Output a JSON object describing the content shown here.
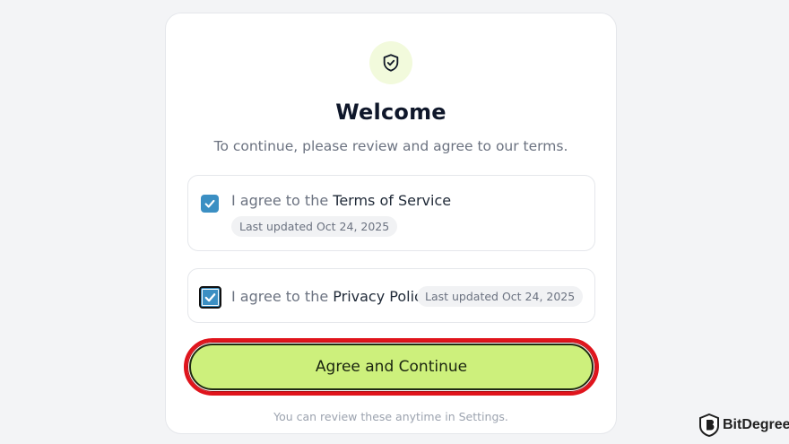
{
  "dialog": {
    "title": "Welcome",
    "subtitle": "To continue, please review and agree to our terms.",
    "icon": "shield-check-icon",
    "accent_color": "#cdf07c"
  },
  "terms": [
    {
      "prefix": "I agree to the ",
      "name": "Terms of Service",
      "updated": "Last updated Oct 24, 2025",
      "checked": true
    },
    {
      "prefix": "I agree to the ",
      "name": "Privacy Policy",
      "updated": "Last updated Oct 24, 2025",
      "checked": true
    }
  ],
  "cta": {
    "label": "Agree and Continue",
    "highlight_color": "#e0141c"
  },
  "footnote": "You can review these anytime in Settings.",
  "watermark": {
    "text": "BitDegree"
  }
}
